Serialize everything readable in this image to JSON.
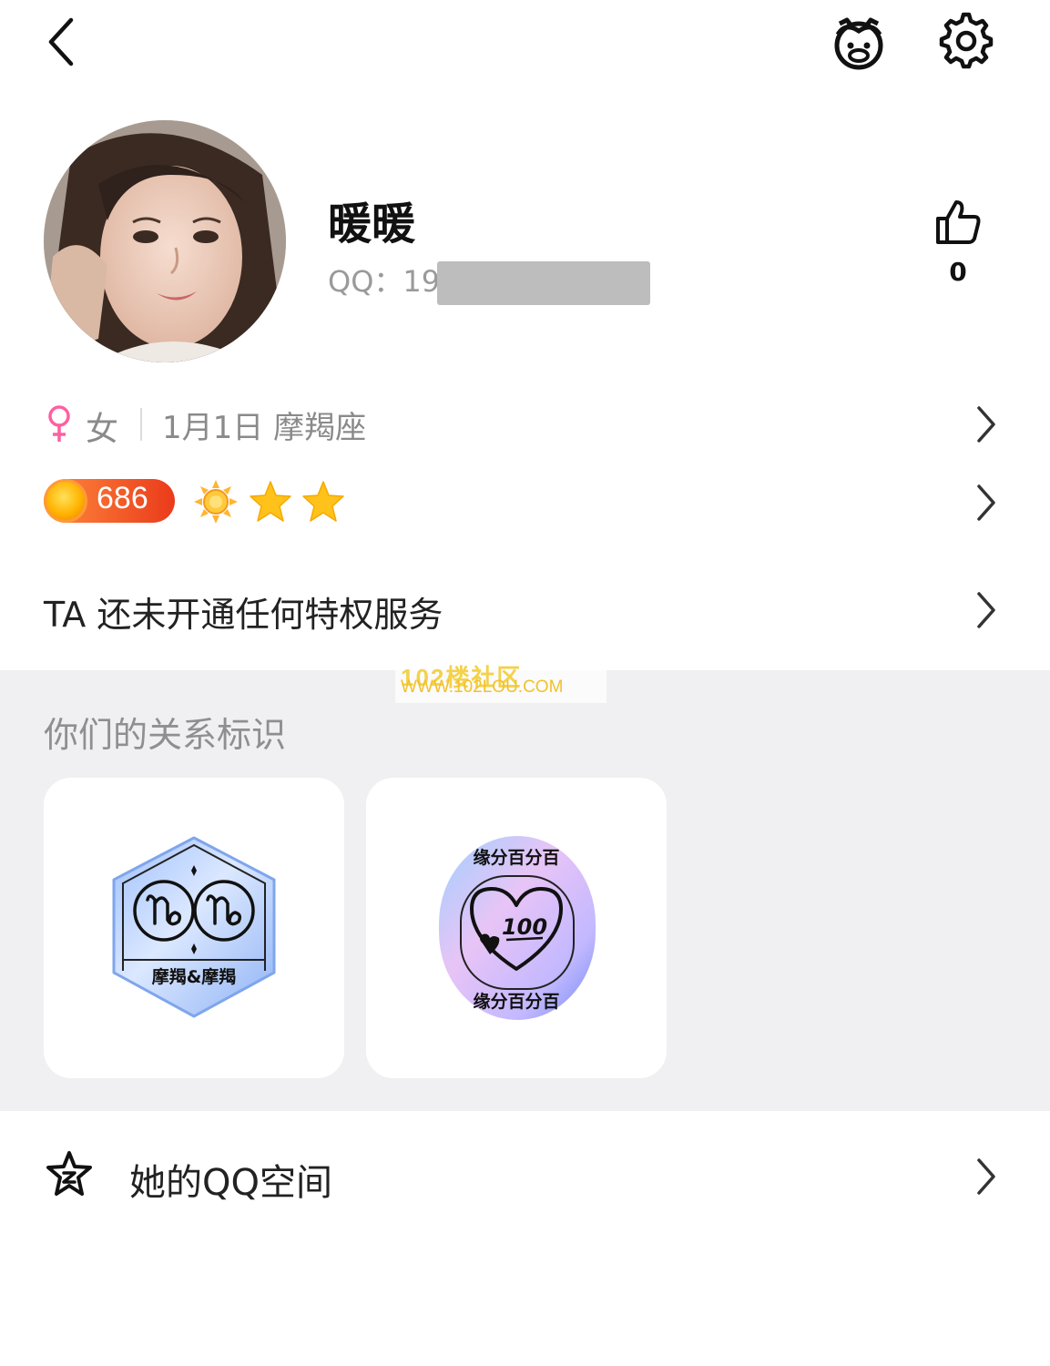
{
  "header": {
    "back_icon": "chevron-left-icon",
    "kids_icon": "bear-face-icon",
    "settings_icon": "gear-icon"
  },
  "profile": {
    "name": "暖暖",
    "qq_label": "QQ：19",
    "likes": "0"
  },
  "info": {
    "gender": "女",
    "birthday_sign": "1月1日 摩羯座"
  },
  "level": {
    "value": "686"
  },
  "privilege": {
    "text": "TA 还未开通任何特权服务"
  },
  "watermark": {
    "line1": "102楼社区",
    "line2": "WWW.102LOU.COM"
  },
  "relations": {
    "title": "你们的关系标识",
    "badges": [
      {
        "label": "摩羯&摩羯"
      },
      {
        "top_text": "缘分百分百",
        "bottom_text": "缘分百分百",
        "score": "100"
      }
    ]
  },
  "qzone": {
    "label": "她的QQ空间"
  },
  "colors": {
    "female": "#ff5fa2",
    "level_badge": "#ea3b1b",
    "section_bg": "#f0f0f3"
  }
}
